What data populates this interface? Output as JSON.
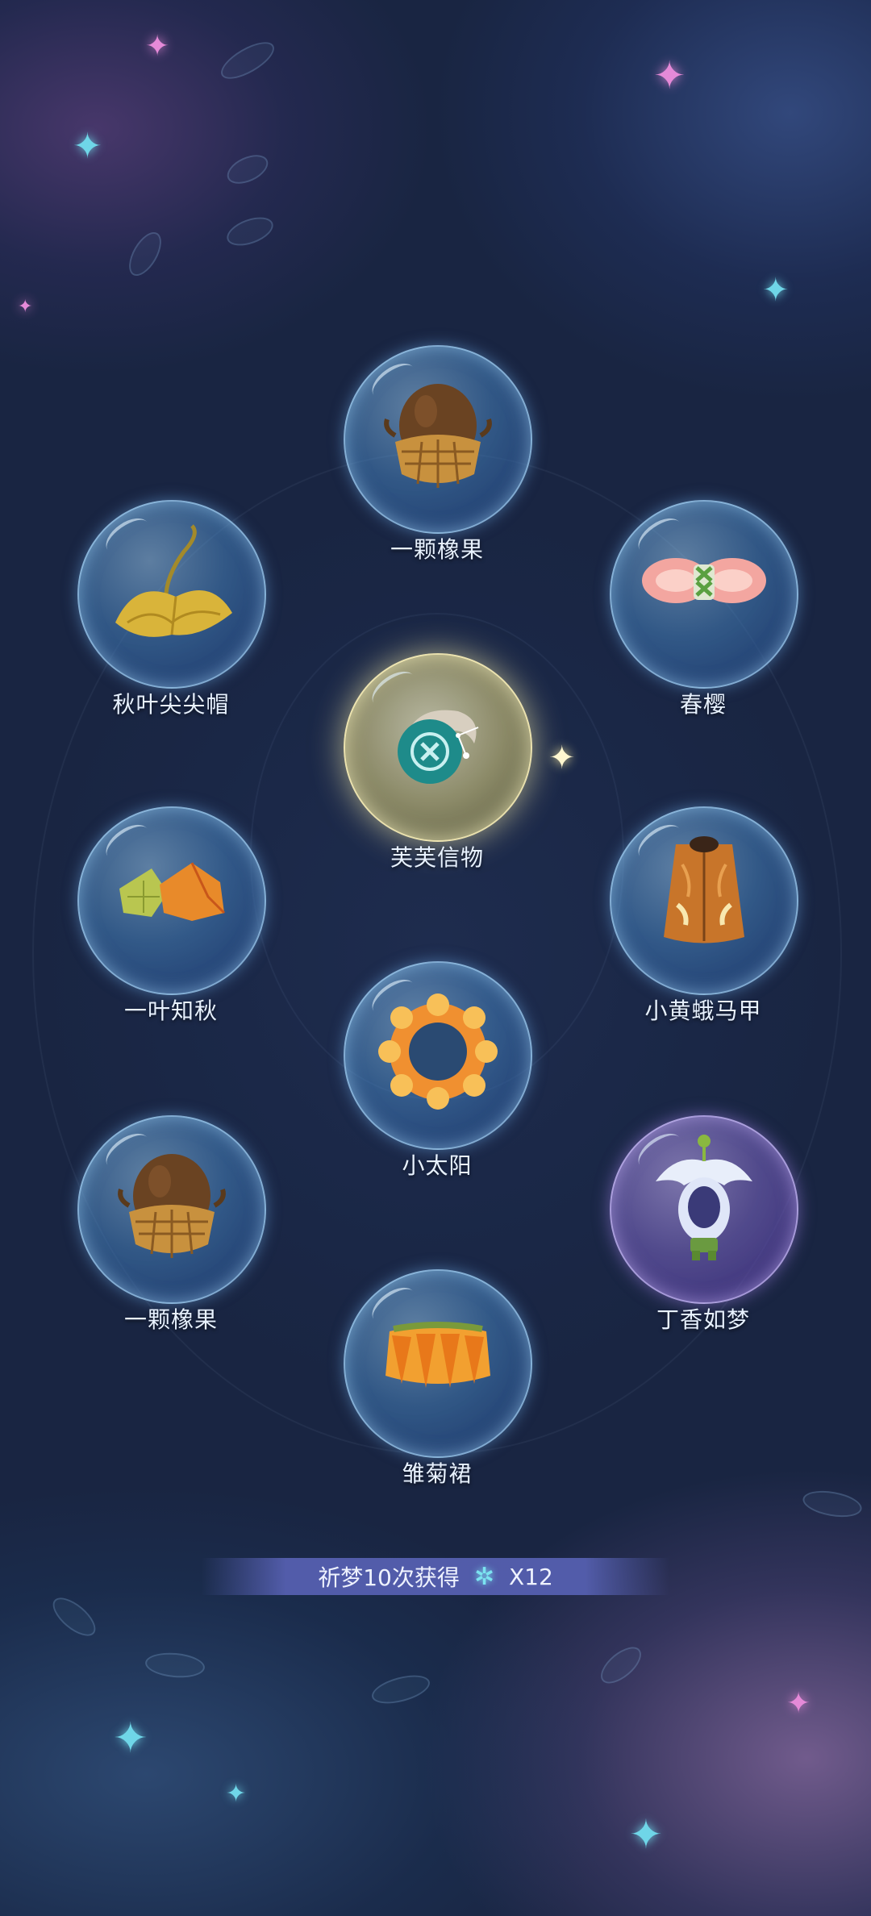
{
  "rewards": [
    {
      "id": "acorn-top",
      "label": "一颗橡果",
      "icon": "acorn-hat-icon",
      "bubble": "blue"
    },
    {
      "id": "autumn-leaf-hat",
      "label": "秋叶尖尖帽",
      "icon": "ginkgo-leaf-icon",
      "bubble": "blue"
    },
    {
      "id": "spring-cherry",
      "label": "春樱",
      "icon": "cherry-blossom-bow-icon",
      "bubble": "blue"
    },
    {
      "id": "fufu-token",
      "label": "芙芙信物",
      "icon": "fufu-token-icon",
      "bubble": "gold"
    },
    {
      "id": "leaf-autumn",
      "label": "一叶知秋",
      "icon": "autumn-leaves-icon",
      "bubble": "blue"
    },
    {
      "id": "yellow-moth-vest",
      "label": "小黄蛾马甲",
      "icon": "moth-vest-icon",
      "bubble": "blue"
    },
    {
      "id": "little-sun",
      "label": "小太阳",
      "icon": "sun-ring-icon",
      "bubble": "blue"
    },
    {
      "id": "acorn-left",
      "label": "一颗橡果",
      "icon": "acorn-hat-icon",
      "bubble": "blue"
    },
    {
      "id": "lilac-dream",
      "label": "丁香如梦",
      "icon": "lilac-hood-icon",
      "bubble": "purple"
    },
    {
      "id": "daisy-skirt",
      "label": "雏菊裙",
      "icon": "daisy-skirt-icon",
      "bubble": "blue"
    }
  ],
  "banner": {
    "prefix": "祈梦10次获得",
    "currency_icon": "dream-star-icon",
    "count": "X12"
  }
}
